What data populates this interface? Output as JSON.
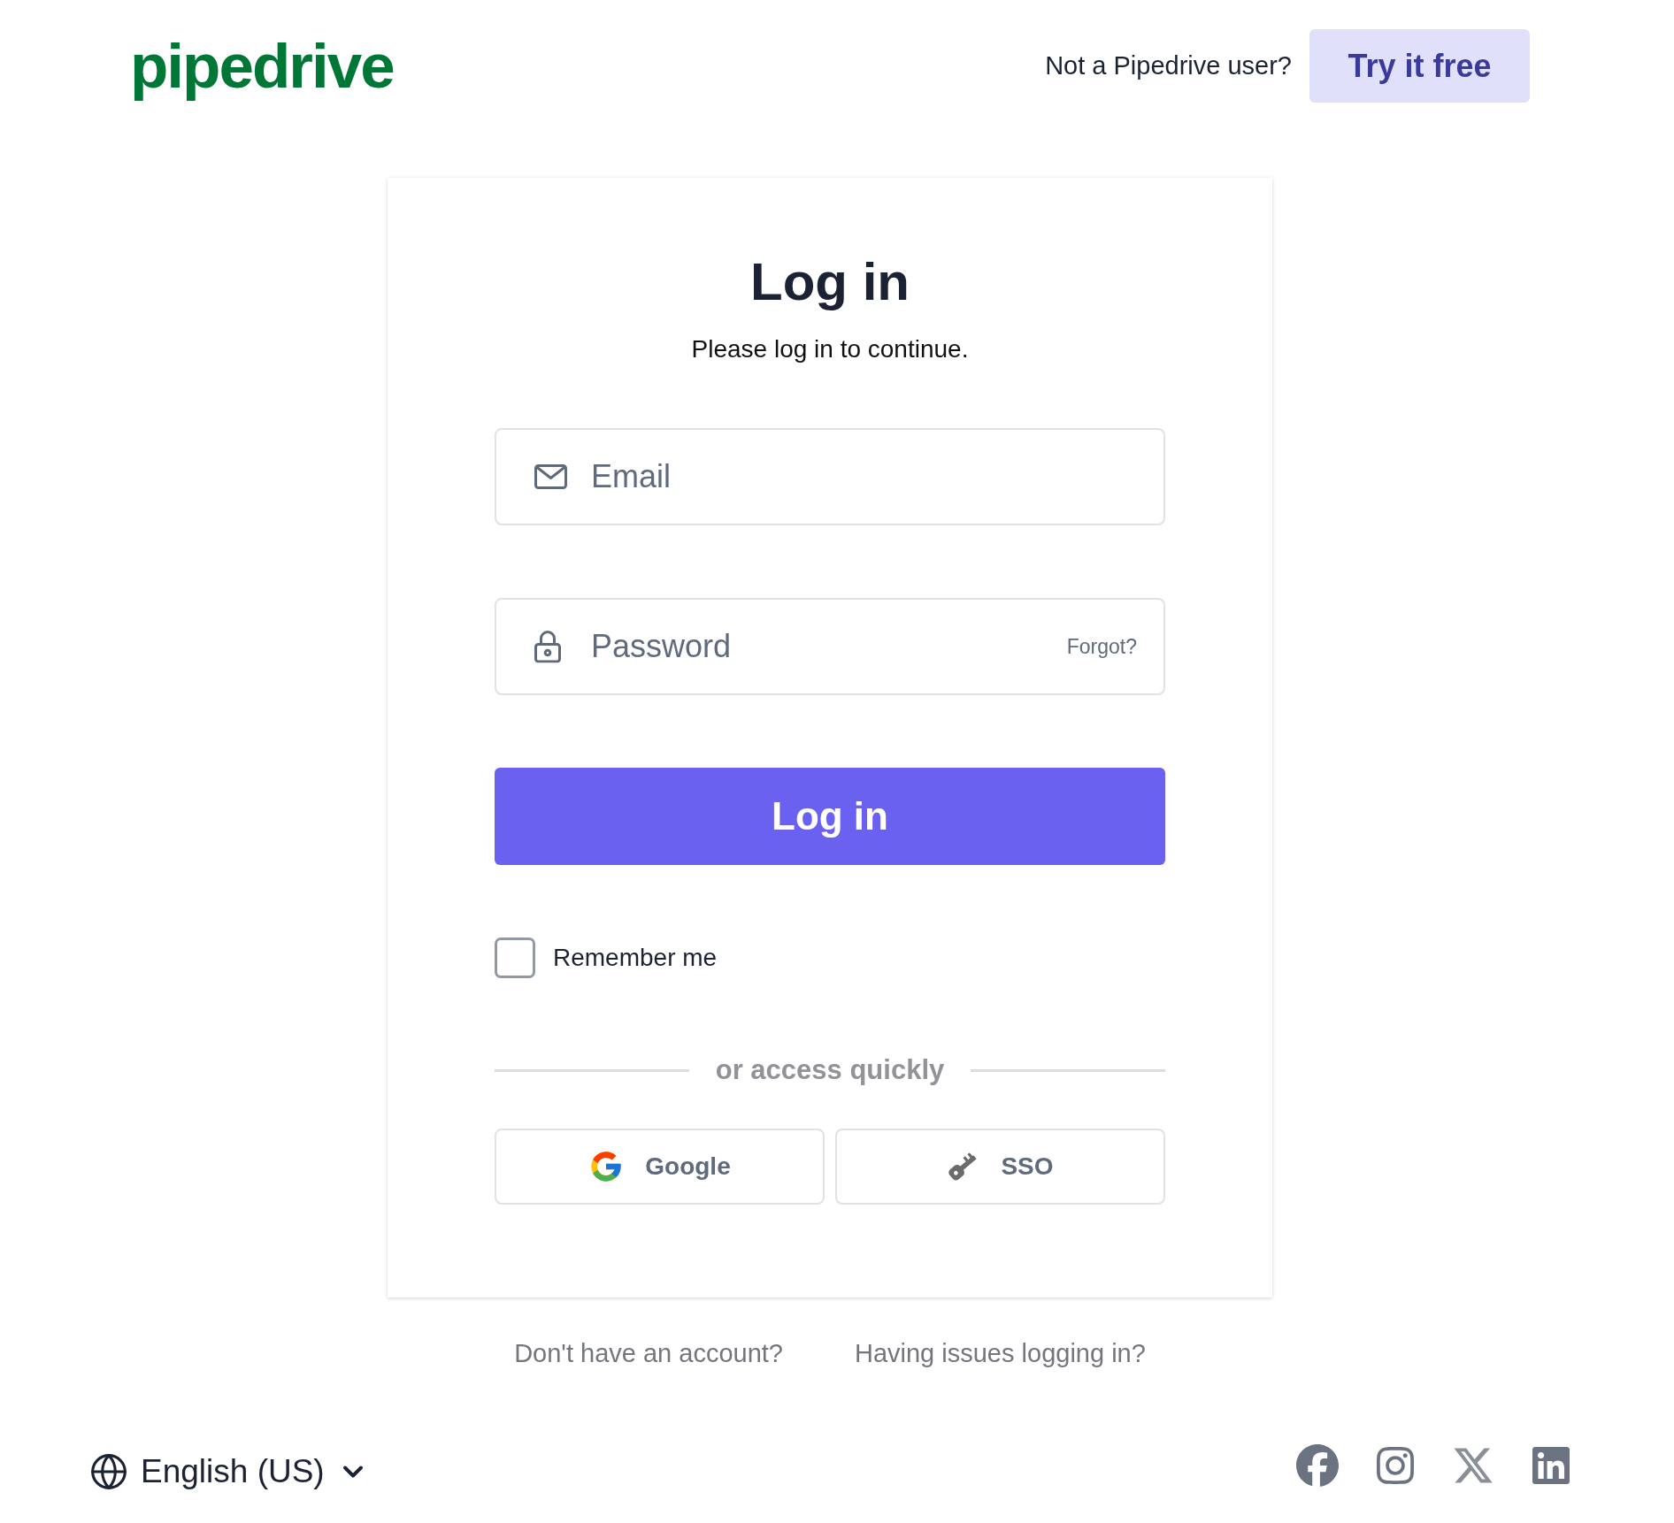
{
  "header": {
    "logo": "pipedrive",
    "prompt": "Not a Pipedrive user?",
    "cta_button": "Try it free"
  },
  "login_card": {
    "title": "Log in",
    "subtitle": "Please log in to continue.",
    "email_field": {
      "placeholder": "Email"
    },
    "password_field": {
      "placeholder": "Password",
      "forgot_link": "Forgot?"
    },
    "submit_button": "Log in",
    "remember_me": {
      "label": "Remember me",
      "checked": false
    },
    "divider_text": "or access quickly",
    "quick_access": [
      {
        "kind": "google",
        "label": "Google"
      },
      {
        "kind": "sso",
        "label": "SSO"
      }
    ]
  },
  "help_links": [
    "Don't have an account?",
    "Having issues logging in?"
  ],
  "footer": {
    "language": "English (US)",
    "social_links": [
      {
        "kind": "facebook"
      },
      {
        "kind": "instagram"
      },
      {
        "kind": "x"
      },
      {
        "kind": "linkedin"
      }
    ]
  }
}
